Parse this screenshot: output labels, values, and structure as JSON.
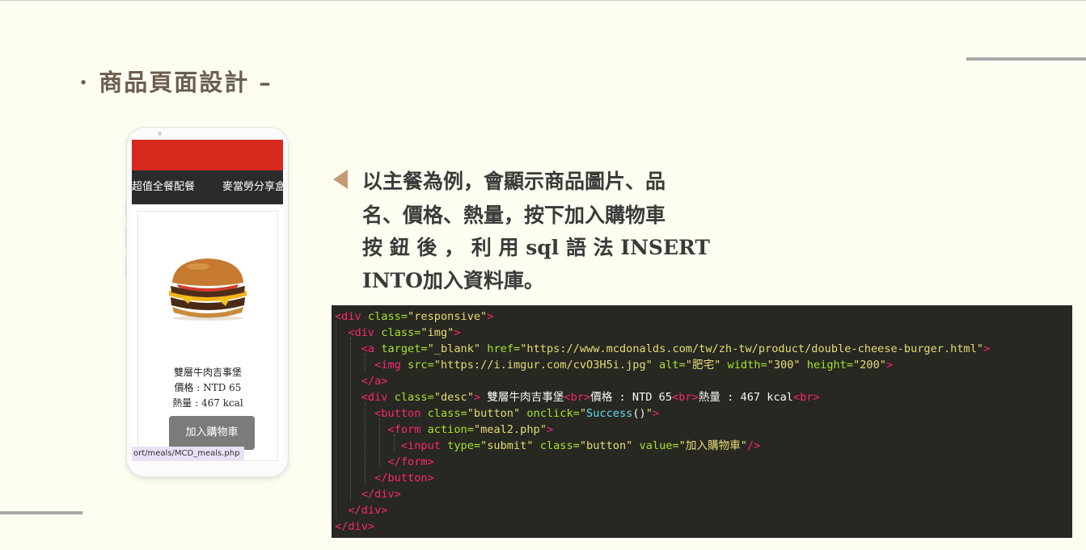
{
  "slide": {
    "title": "· 商品頁面設計 –",
    "description_lines": [
      "以主餐為例，會顯示商品圖片、品",
      "名、價格、熱量，按下加入購物車",
      "按 鈕 後 ， 利 用 sql 語 法 INSERT",
      "INTO加入資料庫。"
    ]
  },
  "phone": {
    "nav_items": [
      "超值全餐配餐",
      "麥當勞分享盒"
    ],
    "product": {
      "name": "雙層牛肉吉事堡",
      "price": "價格 : NTD 65",
      "calories": "熱量 : 467 kcal",
      "button_label": "加入購物車"
    },
    "status_url": "ort/meals/MCD_meals.php"
  },
  "code": {
    "lines": [
      [
        [
          "tag",
          "<div "
        ],
        [
          "attr",
          "class="
        ],
        [
          "str",
          "\"responsive\""
        ],
        [
          "tag",
          ">"
        ]
      ],
      [
        [
          "txt",
          "  "
        ],
        [
          "tag",
          "<div "
        ],
        [
          "attr",
          "class="
        ],
        [
          "str",
          "\"img\""
        ],
        [
          "tag",
          ">"
        ]
      ],
      [
        [
          "txt",
          "    "
        ],
        [
          "tag",
          "<a "
        ],
        [
          "attr",
          "target="
        ],
        [
          "str",
          "\"_blank\""
        ],
        [
          "txt",
          " "
        ],
        [
          "attr",
          "href="
        ],
        [
          "str",
          "\"https://www.mcdonalds.com/tw/zh-tw/product/double-cheese-burger.html\""
        ],
        [
          "tag",
          ">"
        ]
      ],
      [
        [
          "txt",
          "      "
        ],
        [
          "tag",
          "<img "
        ],
        [
          "attr",
          "src="
        ],
        [
          "str",
          "\"https://i.imgur.com/cvO3H5i.jpg\""
        ],
        [
          "txt",
          " "
        ],
        [
          "attr",
          "alt="
        ],
        [
          "str",
          "\"肥宅\""
        ],
        [
          "txt",
          " "
        ],
        [
          "attr",
          "width="
        ],
        [
          "str",
          "\"300\""
        ],
        [
          "txt",
          " "
        ],
        [
          "attr",
          "height="
        ],
        [
          "str",
          "\"200\""
        ],
        [
          "tag",
          ">"
        ]
      ],
      [
        [
          "txt",
          "    "
        ],
        [
          "tag",
          "</a>"
        ]
      ],
      [
        [
          "txt",
          "    "
        ],
        [
          "tag",
          "<div "
        ],
        [
          "attr",
          "class="
        ],
        [
          "str",
          "\"desc\""
        ],
        [
          "tag",
          ">"
        ],
        [
          "txt",
          " 雙層牛肉吉事堡"
        ],
        [
          "tag",
          "<br>"
        ],
        [
          "txt",
          "價格 : NTD 65"
        ],
        [
          "tag",
          "<br>"
        ],
        [
          "txt",
          "熱量 : 467 kcal"
        ],
        [
          "tag",
          "<br>"
        ]
      ],
      [
        [
          "txt",
          "      "
        ],
        [
          "tag",
          "<button "
        ],
        [
          "attr",
          "class="
        ],
        [
          "str",
          "\"button\""
        ],
        [
          "txt",
          " "
        ],
        [
          "attr",
          "onclick="
        ],
        [
          "str",
          "\""
        ],
        [
          "fn",
          "Success"
        ],
        [
          "txt",
          "()"
        ],
        [
          "str",
          "\""
        ],
        [
          "tag",
          ">"
        ]
      ],
      [
        [
          "txt",
          "        "
        ],
        [
          "tag",
          "<form "
        ],
        [
          "attr",
          "action="
        ],
        [
          "str",
          "\"meal2.php\""
        ],
        [
          "tag",
          ">"
        ]
      ],
      [
        [
          "txt",
          "          "
        ],
        [
          "tag",
          "<input "
        ],
        [
          "attr",
          "type="
        ],
        [
          "str",
          "\"submit\""
        ],
        [
          "txt",
          " "
        ],
        [
          "attr",
          "class="
        ],
        [
          "str",
          "\"button\""
        ],
        [
          "txt",
          " "
        ],
        [
          "attr",
          "value="
        ],
        [
          "str",
          "\"加入購物車\""
        ],
        [
          "tag",
          "/>"
        ]
      ],
      [
        [
          "txt",
          "        "
        ],
        [
          "tag",
          "</form>"
        ]
      ],
      [
        [
          "txt",
          "      "
        ],
        [
          "tag",
          "</button>"
        ]
      ],
      [
        [
          "txt",
          "    "
        ],
        [
          "tag",
          "</div>"
        ]
      ],
      [
        [
          "txt",
          "  "
        ],
        [
          "tag",
          "</div>"
        ]
      ],
      [
        [
          "tag",
          "</div>"
        ]
      ]
    ]
  },
  "colors": {
    "background": "#fefdf1",
    "title": "#6b5e50",
    "bullet": "#c79a73",
    "code_bg": "#272822",
    "header_red": "#d5291d"
  }
}
